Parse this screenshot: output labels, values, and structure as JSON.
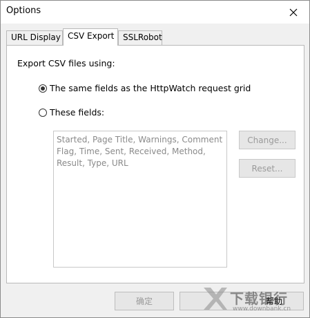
{
  "window": {
    "title": "Options",
    "close_icon": "close-icon"
  },
  "tabs": [
    {
      "label": "URL Display"
    },
    {
      "label": "CSV Export",
      "active": true
    },
    {
      "label": "SSLRobot"
    }
  ],
  "panel": {
    "label": "Export CSV files using:",
    "option_same": "The same fields as the HttpWatch request grid",
    "option_same_selected": true,
    "option_these": "These fields:",
    "option_these_selected": false,
    "fields_text": "Started, Page Title, Warnings, Comment Flag, Time, Sent, Received, Method, Result, Type, URL",
    "change_button": "Change...",
    "reset_button": "Reset..."
  },
  "footer": {
    "ok_button": "确定",
    "help_button": "帮助"
  },
  "watermark": {
    "brand": "下载银行",
    "url": "www.downbank.cn"
  },
  "colors": {
    "window_bg": "#f0f0f0",
    "panel_bg": "#ffffff",
    "disabled_text": "#9a9a9a"
  }
}
